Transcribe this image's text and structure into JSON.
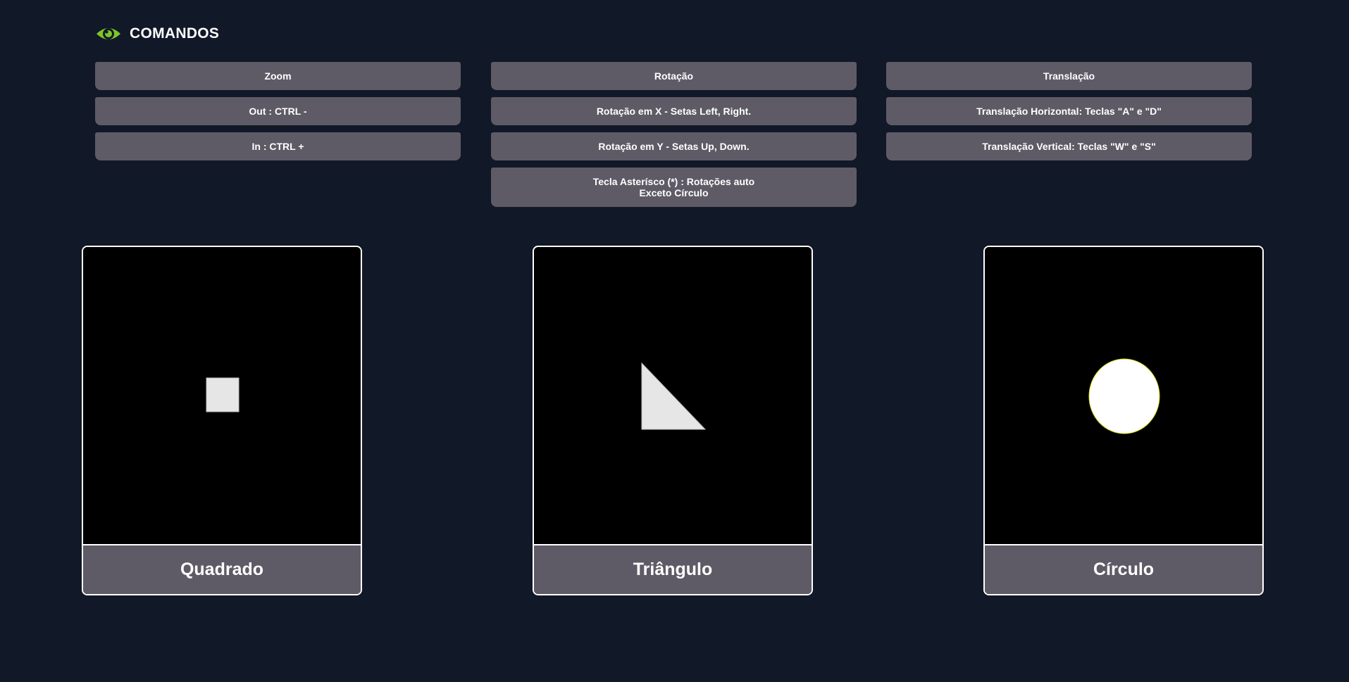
{
  "header": {
    "title": "COMANDOS",
    "icon": "eye-icon",
    "icon_color": "#7cc52a"
  },
  "commands": {
    "zoom": {
      "title": "Zoom",
      "items": [
        "Out : CTRL -",
        "In : CTRL +"
      ]
    },
    "rotation": {
      "title": "Rotação",
      "items": [
        "Rotação em X - Setas Left, Right.",
        "Rotação em Y - Setas Up, Down.",
        "Tecla Asterísco (*) : Rotações auto\nExceto Círculo"
      ]
    },
    "translation": {
      "title": "Translação",
      "items": [
        "Translação Horizontal: Teclas \"A\" e \"D\"",
        "Translação Vertical: Teclas \"W\" e \"S\""
      ]
    }
  },
  "shapes": [
    {
      "label": "Quadrado",
      "shape": "square",
      "fill": "#e6e6e6"
    },
    {
      "label": "Triângulo",
      "shape": "triangle",
      "fill": "#e6e6e6"
    },
    {
      "label": "Círculo",
      "shape": "circle",
      "fill": "#ffffff",
      "stroke": "#d9e021"
    }
  ],
  "colors": {
    "background": "#111827",
    "button": "#5f5b66",
    "canvas": "#000000"
  }
}
